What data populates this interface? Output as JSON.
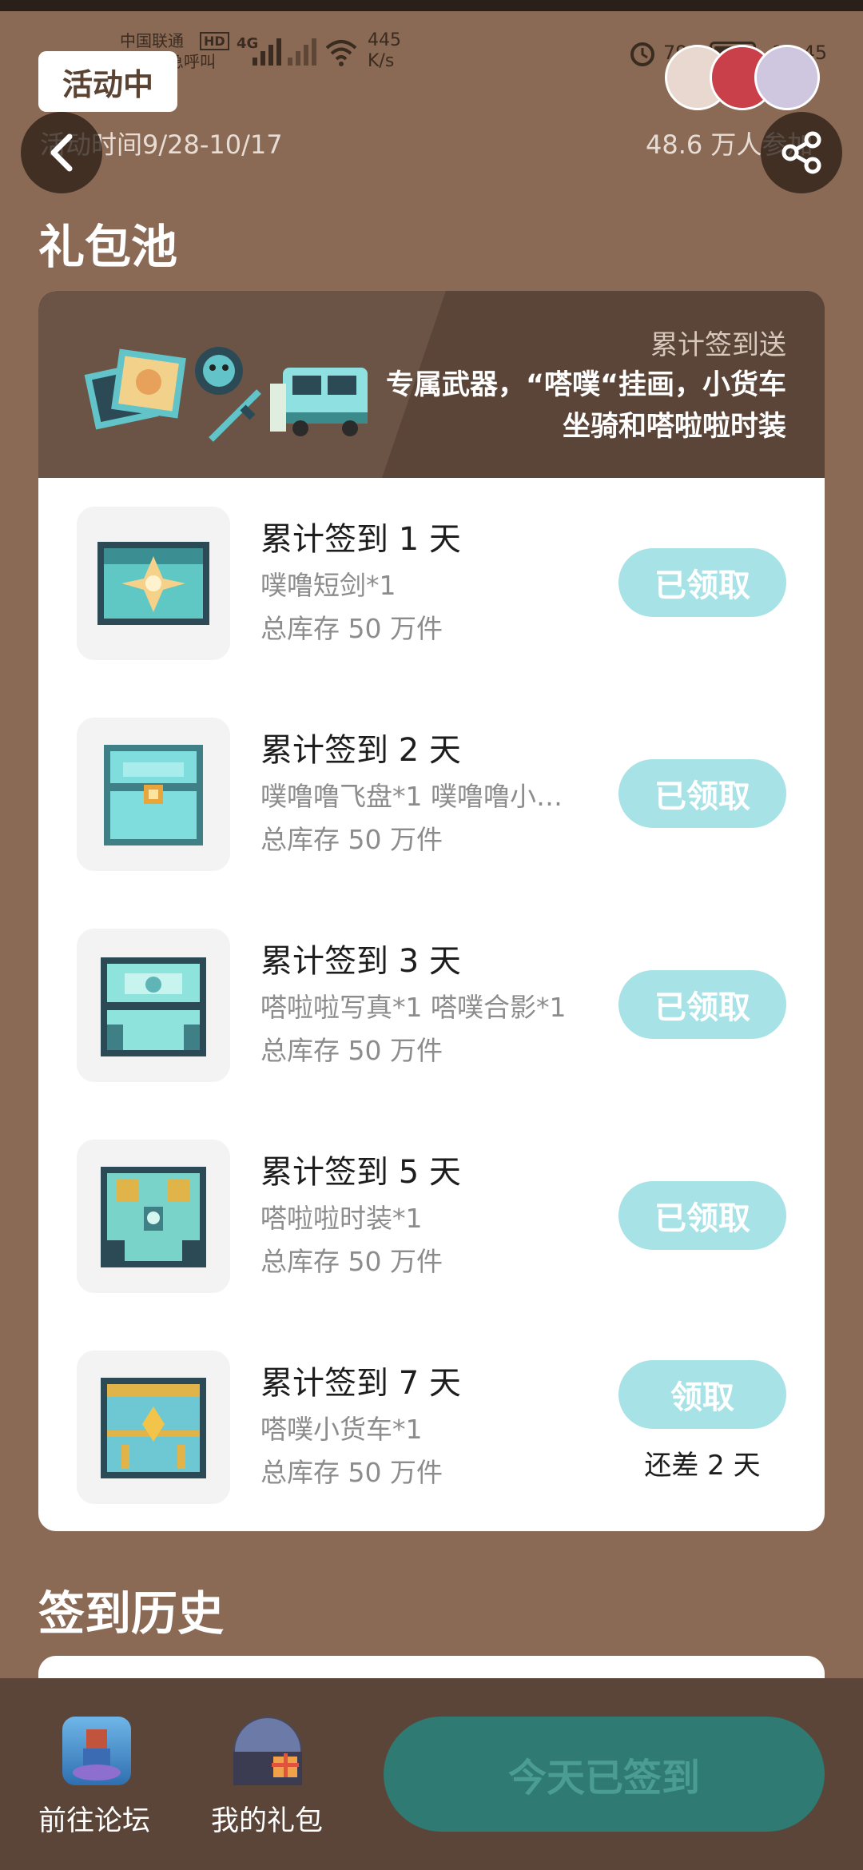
{
  "status_bar": {
    "carrier_line1": "中国联通",
    "carrier_line2": "仅限紧急呼叫",
    "hd": "HD",
    "network": "4G",
    "speed_value": "445",
    "speed_unit": "K/s",
    "battery": "79%",
    "time": "10:45"
  },
  "header": {
    "badge": "活动中",
    "period": "活动时间9/28-10/17",
    "participants": "48.6 万人参加"
  },
  "gift_pool": {
    "title": "礼包池",
    "banner_sub": "累计签到送",
    "banner_main": "专属武器，“嗒噗“挂画，小货车坐骑和嗒啦啦时装",
    "rows": [
      {
        "title": "累计签到 1 天",
        "items": "噗噜短剑*1",
        "stock": "总库存 50 万件",
        "button": "已领取",
        "remain": ""
      },
      {
        "title": "累计签到 2 天",
        "items": "噗噜噜飞盘*1 噗噜噜小…",
        "stock": "总库存 50 万件",
        "button": "已领取",
        "remain": ""
      },
      {
        "title": "累计签到 3 天",
        "items": "嗒啦啦写真*1 嗒噗合影*1",
        "stock": "总库存 50 万件",
        "button": "已领取",
        "remain": ""
      },
      {
        "title": "累计签到 5 天",
        "items": "嗒啦啦时装*1",
        "stock": "总库存 50 万件",
        "button": "已领取",
        "remain": ""
      },
      {
        "title": "累计签到 7 天",
        "items": "嗒噗小货车*1",
        "stock": "总库存 50 万件",
        "button": "领取",
        "remain": "还差 2 天"
      }
    ]
  },
  "history": {
    "title": "签到历史"
  },
  "bottom_bar": {
    "forum_label": "前往论坛",
    "gifts_label": "我的礼包",
    "main_button": "今天已签到"
  },
  "colors": {
    "background": "#8B6A55",
    "banner": "#5A4538",
    "claim_button": "#a7e3e6",
    "main_button": "#2F7A72"
  }
}
